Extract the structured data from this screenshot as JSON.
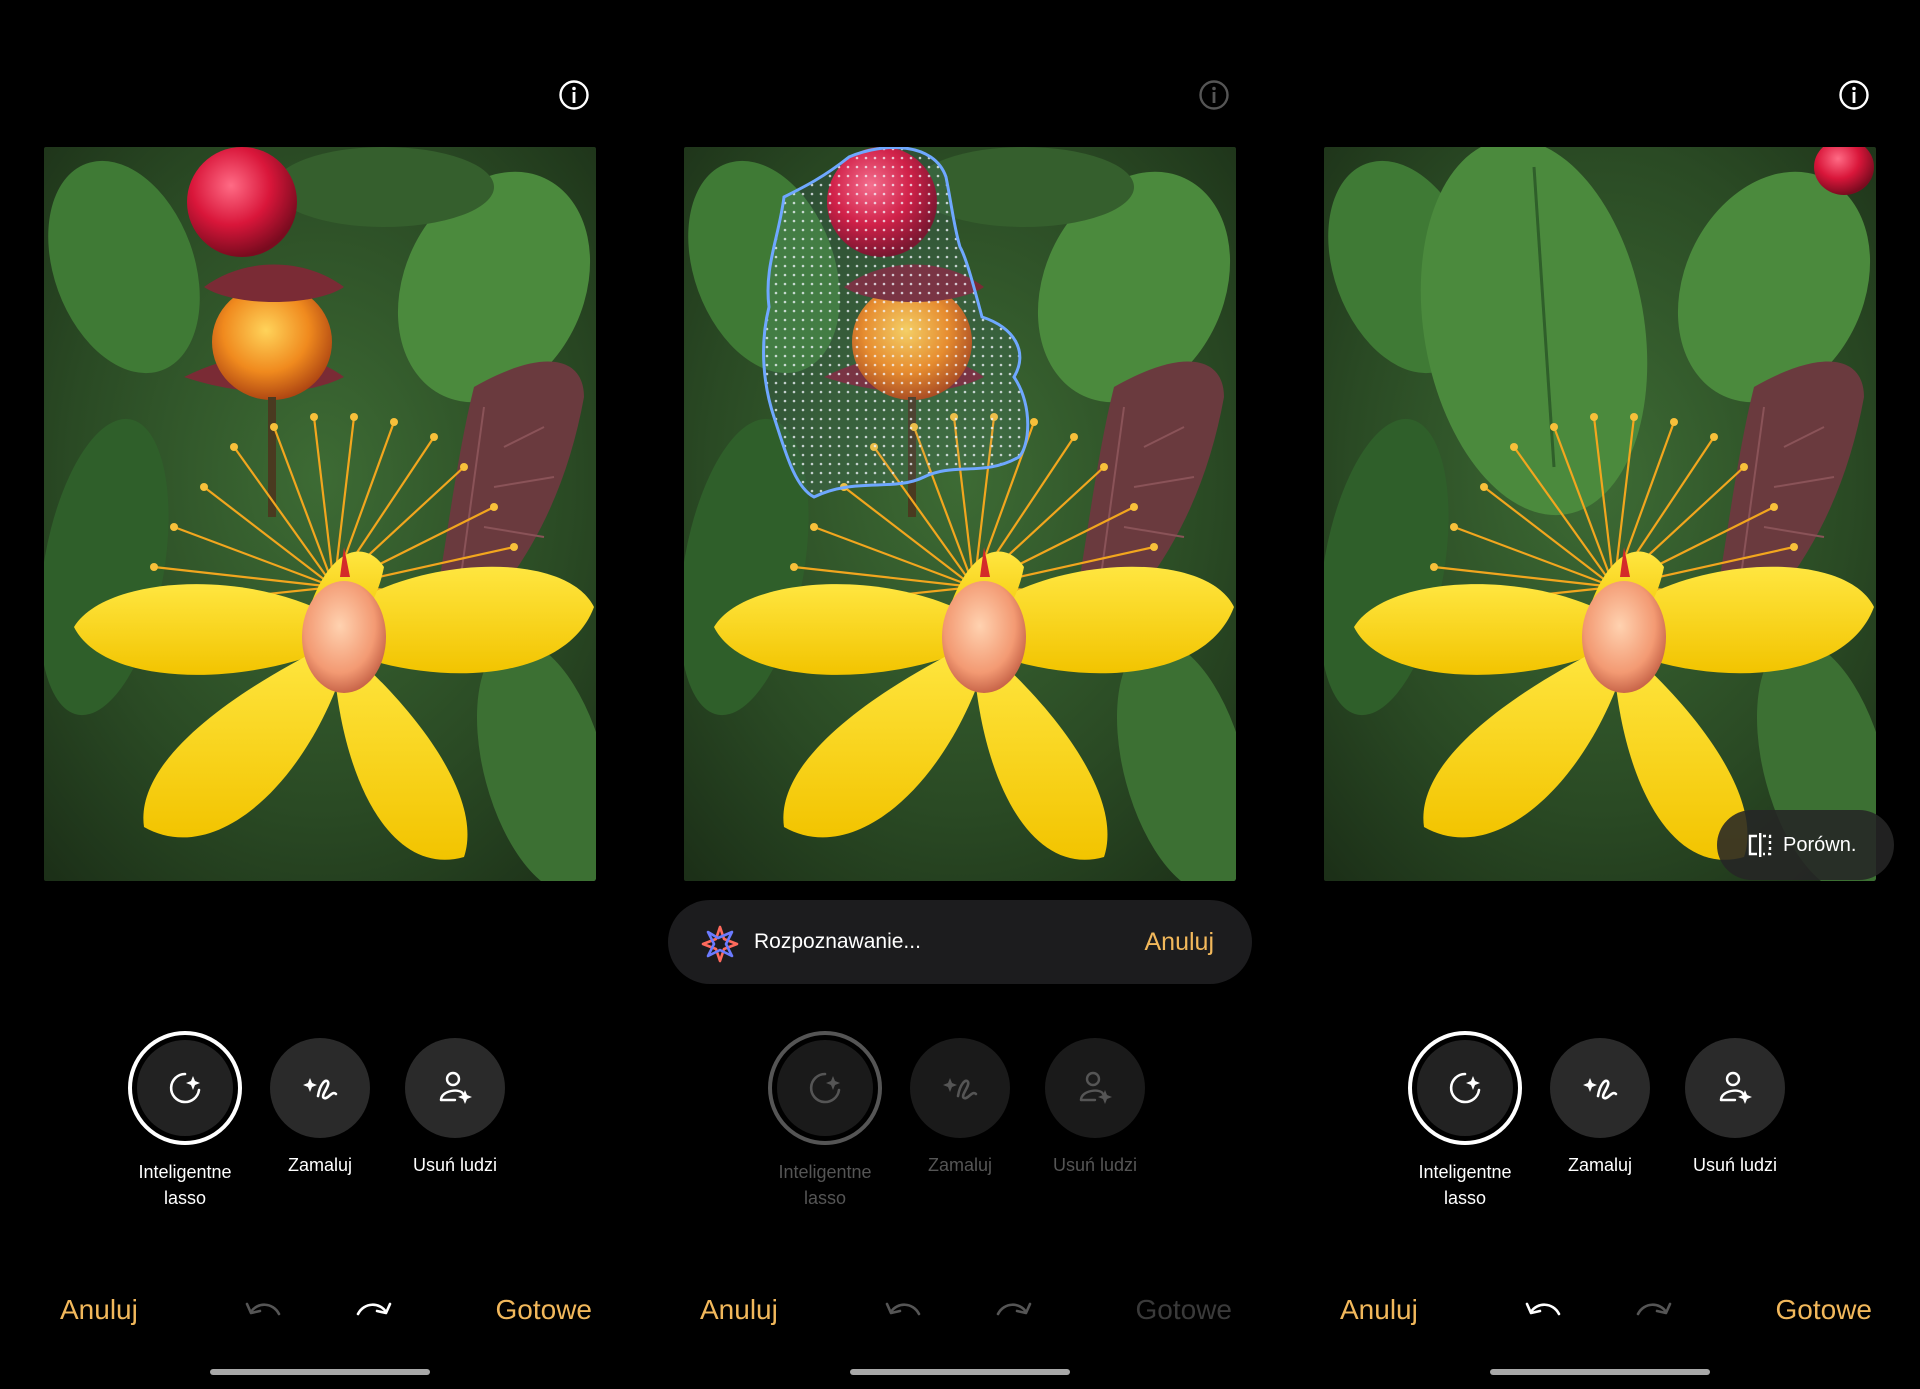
{
  "panels": [
    {
      "info_icon": "info-icon",
      "tools": [
        {
          "label": "Inteligentne\nlasso",
          "icon": "smart-lasso-icon",
          "selected": true
        },
        {
          "label": "Zamaluj",
          "icon": "paint-over-icon",
          "selected": false
        },
        {
          "label": "Usuń ludzi",
          "icon": "remove-people-icon",
          "selected": false
        }
      ],
      "cancel_label": "Anuluj",
      "done_label": "Gotowe",
      "undo_icon": "undo-icon",
      "redo_icon": "redo-icon"
    },
    {
      "info_icon": "info-icon",
      "recognition": {
        "text": "Rozpoznawanie...",
        "cancel_label": "Anuluj"
      },
      "tools": [
        {
          "label": "Inteligentne\nlasso",
          "icon": "smart-lasso-icon",
          "selected": true
        },
        {
          "label": "Zamaluj",
          "icon": "paint-over-icon",
          "selected": false
        },
        {
          "label": "Usuń ludzi",
          "icon": "remove-people-icon",
          "selected": false
        }
      ],
      "cancel_label": "Anuluj",
      "done_label": "Gotowe",
      "undo_icon": "undo-icon",
      "redo_icon": "redo-icon"
    },
    {
      "info_icon": "info-icon",
      "compare_label": "Porówn.",
      "tools": [
        {
          "label": "Inteligentne\nlasso",
          "icon": "smart-lasso-icon",
          "selected": true
        },
        {
          "label": "Zamaluj",
          "icon": "paint-over-icon",
          "selected": false
        },
        {
          "label": "Usuń ludzi",
          "icon": "remove-people-icon",
          "selected": false
        }
      ],
      "cancel_label": "Anuluj",
      "done_label": "Gotowe",
      "undo_icon": "undo-icon",
      "redo_icon": "redo-icon"
    }
  ],
  "colors": {
    "accent": "#f2b85b",
    "background": "#000000",
    "selection_outline": "#6fa8ff"
  }
}
